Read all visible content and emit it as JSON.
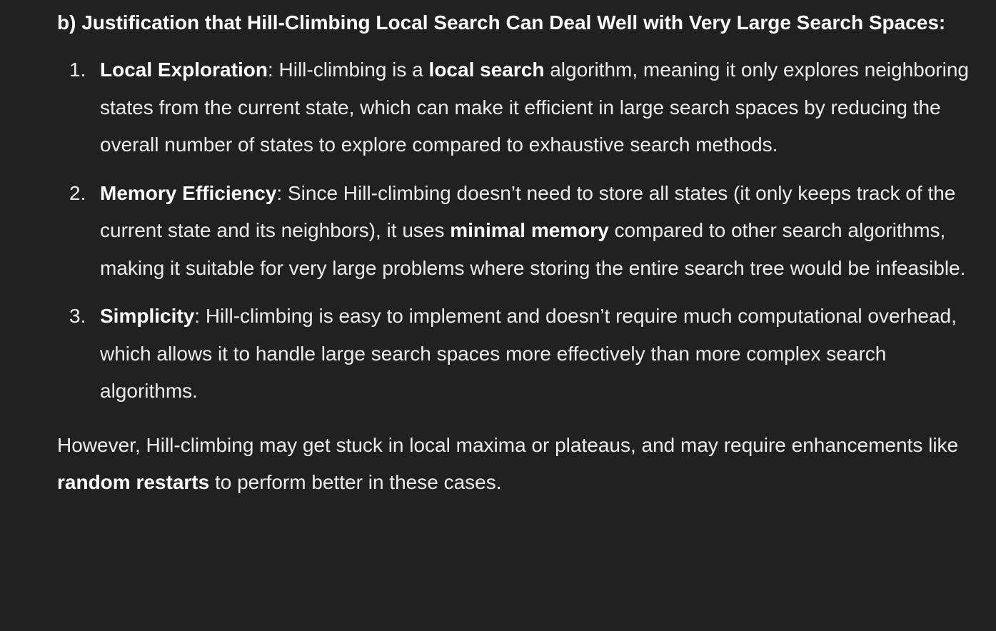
{
  "heading": "b) Justification that Hill-Climbing Local Search Can Deal Well with Very Large Search Spaces:",
  "points": [
    {
      "number": "1.",
      "term": "Local Exploration",
      "seg1": ": Hill-climbing is a ",
      "emphasis": "local search",
      "seg2": " algorithm, meaning it only explores neighboring states from the current state, which can make it efficient in large search spaces by reducing the overall number of states to explore compared to exhaustive search methods."
    },
    {
      "number": "2.",
      "term": "Memory Efficiency",
      "seg1": ": Since Hill-climbing doesn’t need to store all states (it only keeps track of the current state and its neighbors), it uses ",
      "emphasis": "minimal memory",
      "seg2": " compared to other search algorithms, making it suitable for very large problems where storing the entire search tree would be infeasible."
    },
    {
      "number": "3.",
      "term": "Simplicity",
      "seg1": ": Hill-climbing is easy to implement and doesn’t require much computational overhead, which allows it to handle large search spaces more effectively than more complex search algorithms.",
      "emphasis": "",
      "seg2": ""
    }
  ],
  "conclusion": {
    "seg1": "However, Hill-climbing may get stuck in local maxima or plateaus, and may require enhancements like ",
    "emphasis": "random restarts",
    "seg2": " to perform better in these cases."
  },
  "colors": {
    "background": "#212121",
    "text": "#ececec",
    "bold_text": "#ffffff"
  }
}
